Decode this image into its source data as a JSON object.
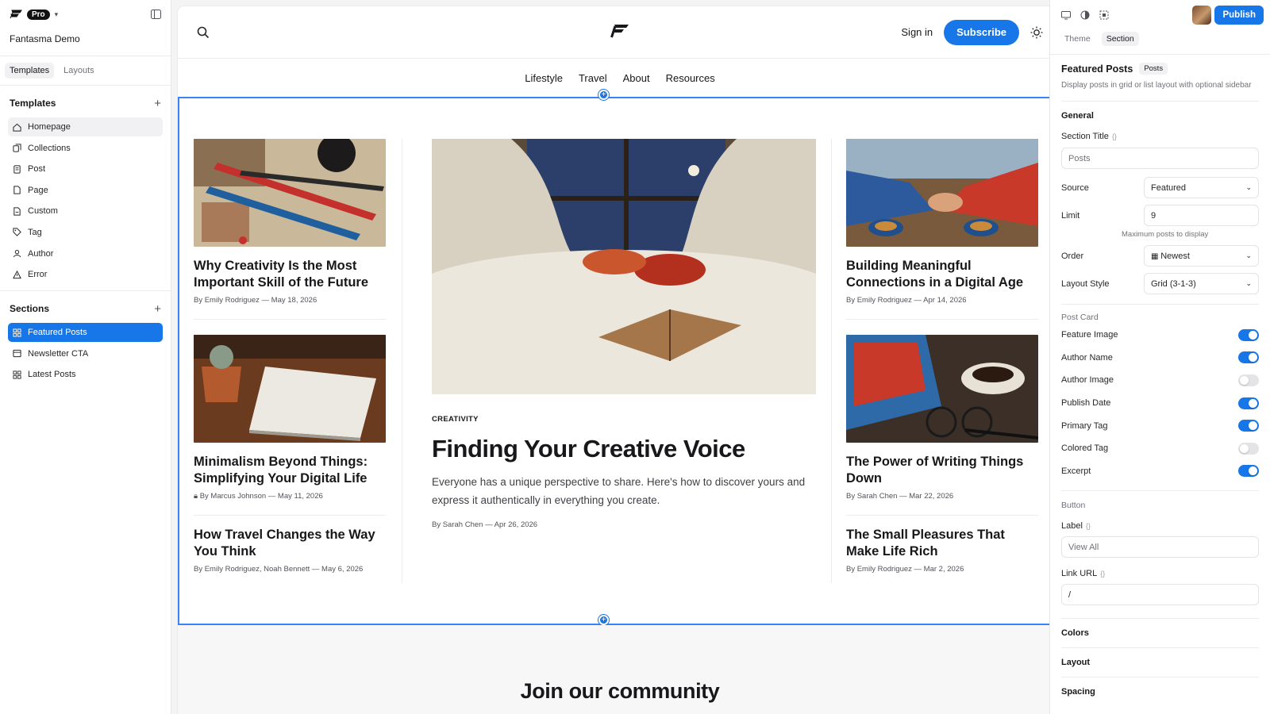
{
  "app": {
    "plan": "Pro",
    "site_name": "Fantasma Demo"
  },
  "left_tabs": [
    "Templates",
    "Layouts"
  ],
  "templates": {
    "heading": "Templates",
    "items": [
      {
        "label": "Homepage",
        "icon": "home-icon"
      },
      {
        "label": "Collections",
        "icon": "collections-icon"
      },
      {
        "label": "Post",
        "icon": "post-icon"
      },
      {
        "label": "Page",
        "icon": "page-icon"
      },
      {
        "label": "Custom",
        "icon": "custom-icon"
      },
      {
        "label": "Tag",
        "icon": "tag-icon"
      },
      {
        "label": "Author",
        "icon": "user-icon"
      },
      {
        "label": "Error",
        "icon": "warning-icon"
      }
    ]
  },
  "sections": {
    "heading": "Sections",
    "items": [
      {
        "label": "Featured Posts",
        "icon": "grid-icon"
      },
      {
        "label": "Newsletter CTA",
        "icon": "window-icon"
      },
      {
        "label": "Latest Posts",
        "icon": "grid-icon"
      }
    ]
  },
  "site": {
    "signin": "Sign in",
    "subscribe": "Subscribe",
    "menu": [
      "Lifestyle",
      "Travel",
      "About",
      "Resources"
    ]
  },
  "posts": {
    "left": [
      {
        "title": "Why Creativity Is the Most Important Skill of the Future",
        "meta": "By Emily Rodriguez — May 18, 2026"
      },
      {
        "title": "Minimalism Beyond Things: Simplifying Your Digital Life",
        "meta": "By Marcus Johnson — May 11, 2026"
      },
      {
        "title": "How Travel Changes the Way You Think",
        "meta": "By Emily Rodriguez, Noah Bennett — May 6, 2026"
      }
    ],
    "featured": {
      "kicker": "CREATIVITY",
      "title": "Finding Your Creative Voice",
      "excerpt": "Everyone has a unique perspective to share. Here's how to discover yours and express it authentically in everything you create.",
      "meta": "By Sarah Chen — Apr 26, 2026"
    },
    "right": [
      {
        "title": "Building Meaningful Connections in a Digital Age",
        "meta": "By Emily Rodriguez — Apr 14, 2026"
      },
      {
        "title": "The Power of Writing Things Down",
        "meta": "By Sarah Chen — Mar 22, 2026"
      },
      {
        "title": "The Small Pleasures That Make Life Rich",
        "meta": "By Emily Rodriguez — Mar 2, 2026"
      }
    ]
  },
  "next_section_title": "Join our community",
  "panel": {
    "publish": "Publish",
    "tabs": [
      "Theme",
      "Section"
    ],
    "title": "Featured Posts",
    "badge": "Posts",
    "description": "Display posts in grid or list layout with optional sidebar",
    "general": "General",
    "section_title_label": "Section Title",
    "section_title_placeholder": "Posts",
    "source_label": "Source",
    "source_value": "Featured",
    "limit_label": "Limit",
    "limit_value": "9",
    "limit_hint": "Maximum posts to display",
    "order_label": "Order",
    "order_value": "Newest",
    "layout_style_label": "Layout Style",
    "layout_style_value": "Grid (3-1-3)",
    "post_card": "Post Card",
    "toggles": [
      {
        "label": "Feature Image",
        "on": true
      },
      {
        "label": "Author Name",
        "on": true
      },
      {
        "label": "Author Image",
        "on": false
      },
      {
        "label": "Publish Date",
        "on": true
      },
      {
        "label": "Primary Tag",
        "on": true
      },
      {
        "label": "Colored Tag",
        "on": false
      },
      {
        "label": "Excerpt",
        "on": true
      }
    ],
    "button_group": "Button",
    "label_label": "Label",
    "label_placeholder": "View All",
    "link_url_label": "Link URL",
    "link_url_value": "/",
    "accordions": [
      "Colors",
      "Layout",
      "Spacing"
    ]
  },
  "colors": {
    "accent": "#1777e8",
    "selection": "#3b82f6"
  }
}
